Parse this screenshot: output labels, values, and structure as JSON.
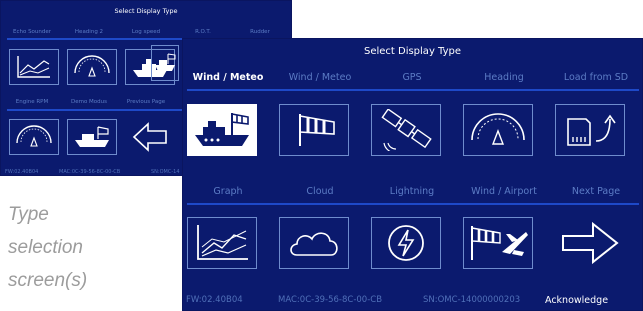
{
  "back_panel": {
    "title": "Select Display Type",
    "tabs": [
      "Echo Sounder",
      "Heading 2",
      "Log speed",
      "R.O.T.",
      "Rudder"
    ],
    "row2_labels": [
      "Engine RPM",
      "Demo Modus",
      "Previous Page"
    ],
    "tiles_row1": [
      "graph-icon",
      "gauge-icon",
      "ship-icon",
      "ship-icon"
    ],
    "tiles_row2": [
      "gauge-icon",
      "ship-wind-icon",
      "arrow-left-icon"
    ],
    "footer": {
      "fw": "FW:02.40B04",
      "mac": "MAC:0C-39-56-8C-00-CB",
      "sn": "SN:OMC-14"
    }
  },
  "front_panel": {
    "title": "Select Display Type",
    "tabs": [
      "Wind / Meteo",
      "Wind / Meteo",
      "GPS",
      "Heading",
      "Load from SD"
    ],
    "row2_labels": [
      "Graph",
      "Cloud",
      "Lightning",
      "Wind / Airport",
      "Next Page"
    ],
    "tiles_row1": [
      "ship-windsock-icon",
      "windsock-icon",
      "satellite-icon",
      "gauge-icon",
      "sd-card-icon"
    ],
    "tiles_row2": [
      "graph-icon",
      "cloud-icon",
      "lightning-icon",
      "windsock-plane-icon",
      "arrow-right-icon"
    ],
    "footer": {
      "fw": "FW:02.40B04",
      "mac": "MAC:0C-39-56-8C-00-CB",
      "sn": "SN:OMC-14000000203",
      "acknowledge": "Acknowledge"
    }
  },
  "caption": {
    "line1": "Type",
    "line2": "selection",
    "line3": "screen(s)"
  },
  "colors": {
    "panel": "#0b1a6e",
    "label": "#5c7cc5",
    "accent": "#1e49c8",
    "tile_border": "#6f8ccd",
    "caption": "#9c9c9c"
  }
}
